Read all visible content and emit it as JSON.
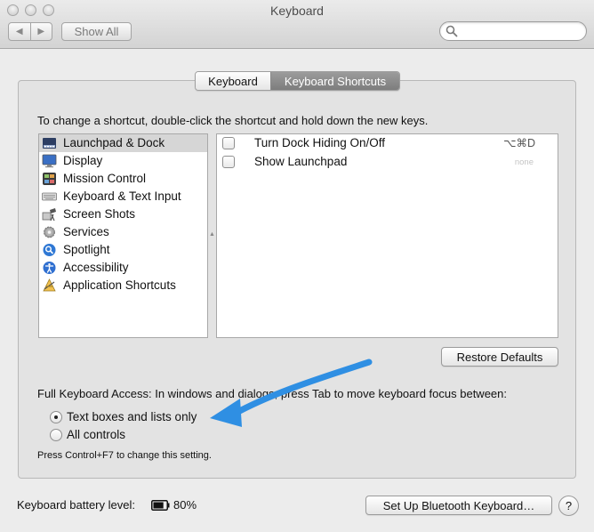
{
  "window": {
    "title": "Keyboard"
  },
  "toolbar": {
    "back_label": "◀",
    "forward_label": "▶",
    "show_all_label": "Show All",
    "search_placeholder": ""
  },
  "tabs": [
    {
      "label": "Keyboard",
      "selected": false
    },
    {
      "label": "Keyboard Shortcuts",
      "selected": true
    }
  ],
  "instructions": "To change a shortcut, double-click the shortcut and hold down the new keys.",
  "categories": [
    {
      "label": "Launchpad & Dock",
      "icon": "launchpad-dock-icon",
      "selected": true
    },
    {
      "label": "Display",
      "icon": "display-icon",
      "selected": false
    },
    {
      "label": "Mission Control",
      "icon": "mission-control-icon",
      "selected": false
    },
    {
      "label": "Keyboard & Text Input",
      "icon": "keyboard-icon",
      "selected": false
    },
    {
      "label": "Screen Shots",
      "icon": "screenshot-icon",
      "selected": false
    },
    {
      "label": "Services",
      "icon": "gear-icon",
      "selected": false
    },
    {
      "label": "Spotlight",
      "icon": "spotlight-icon",
      "selected": false
    },
    {
      "label": "Accessibility",
      "icon": "accessibility-icon",
      "selected": false
    },
    {
      "label": "Application Shortcuts",
      "icon": "app-shortcuts-icon",
      "selected": false
    }
  ],
  "shortcuts": [
    {
      "label": "Turn Dock Hiding On/Off",
      "key": "⌥⌘D",
      "checked": false
    },
    {
      "label": "Show Launchpad",
      "key": "none",
      "checked": false
    }
  ],
  "restore_defaults_label": "Restore Defaults",
  "full_keyboard_access": {
    "label": "Full Keyboard Access: In windows and dialogs, press Tab to move keyboard focus between:",
    "options": [
      {
        "label": "Text boxes and lists only",
        "selected": true
      },
      {
        "label": "All controls",
        "selected": false
      }
    ],
    "hint": "Press Control+F7 to change this setting."
  },
  "battery": {
    "label": "Keyboard battery level:",
    "level": "80%",
    "fraction": 0.8
  },
  "bluetooth_button_label": "Set Up Bluetooth Keyboard…",
  "help_label": "?",
  "colors": {
    "annotation_arrow": "#2f8fe3",
    "selected_row": "#d6d6d6",
    "active_tab": "#8a8a8a"
  }
}
